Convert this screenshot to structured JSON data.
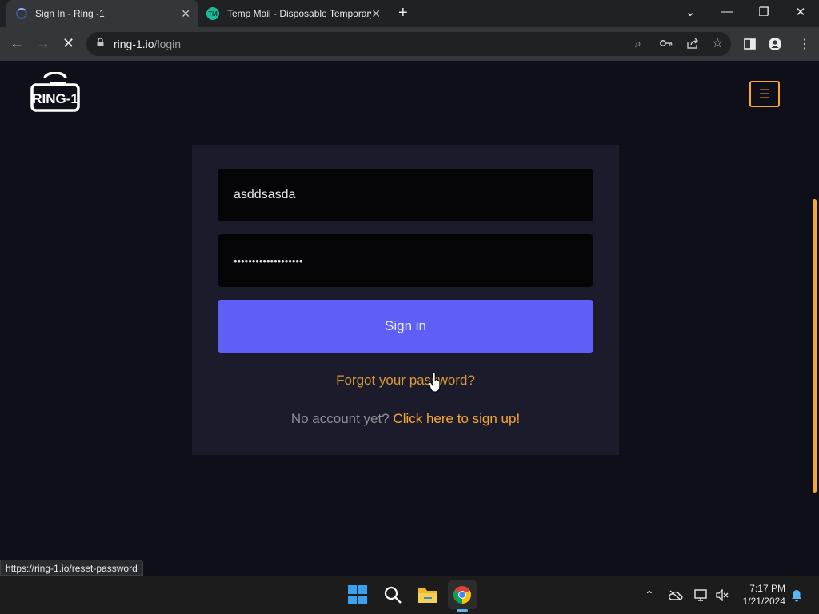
{
  "browser": {
    "tabs": [
      {
        "title": "Sign In - Ring -1",
        "active": true
      },
      {
        "title": "Temp Mail - Disposable Temporary E",
        "active": false
      }
    ],
    "new_tab_symbol": "+",
    "url_host": "ring-1.io",
    "url_path": "/login",
    "status_url": "https://ring-1.io/reset-password"
  },
  "page": {
    "logo_text": "RING-1",
    "username_value": "asddsasda",
    "password_value": "•••••••••••••••••••",
    "signin_label": "Sign in",
    "forgot_label": "Forgot your password?",
    "no_account_text": "No account yet?",
    "signup_link": "Click here to sign up!",
    "accent_color": "#f7a92f",
    "button_color": "#5d5ff6"
  },
  "taskbar": {
    "time": "7:17 PM",
    "date": "1/21/2024",
    "apps": [
      "windows-start-icon",
      "search-icon",
      "file-explorer-icon",
      "chrome-icon"
    ]
  }
}
